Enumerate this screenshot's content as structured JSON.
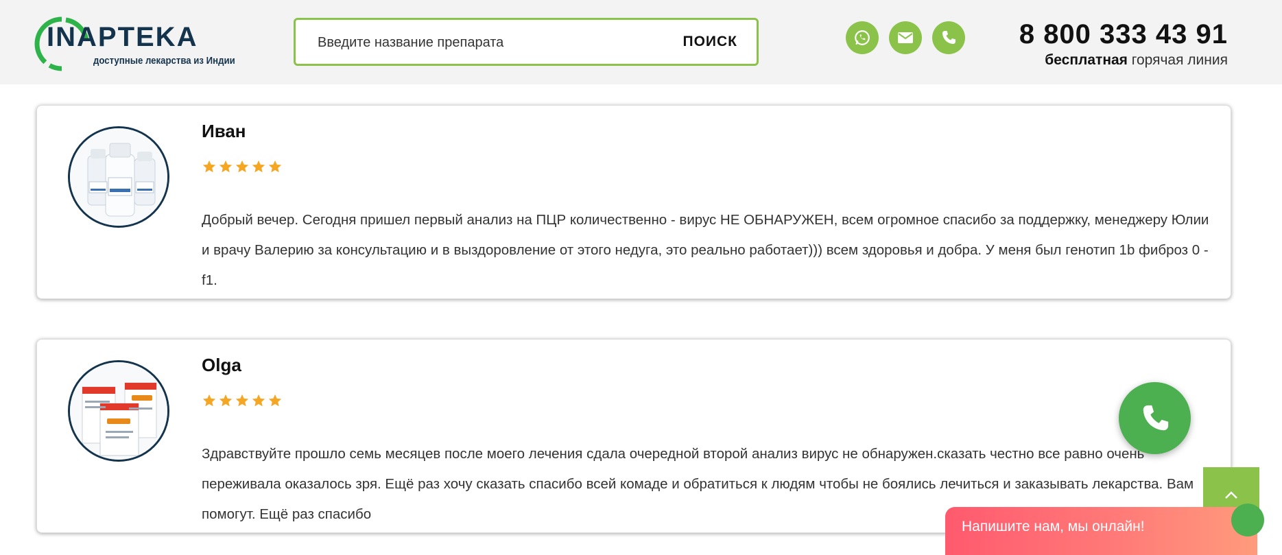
{
  "header": {
    "logo_text": "INAPTEKA",
    "logo_tagline": "доступные лекарства из Индии",
    "search": {
      "placeholder": "Введите название препарата",
      "button_label": "ПОИСК"
    },
    "contact_icons": [
      "whatsapp-icon",
      "mail-icon",
      "phone-icon"
    ],
    "phone": "8 800 333 43 91",
    "hotline_bold": "бесплатная",
    "hotline_rest": " горячая линия"
  },
  "reviews": [
    {
      "name": "Иван",
      "rating": 5,
      "text": "Добрый вечер. Сегодня пришел первый анализ на ПЦР количественно - вирус НЕ ОБНАРУЖЕН, всем огромное спасибо за поддержку, менеджеру Юлии и врачу Валерию за консультацию и в выздоровление от этого недуга, это реально работает))) всем здоровья и добра. У меня был генотип 1b фиброз 0 - f1."
    },
    {
      "name": "Olga",
      "rating": 5,
      "text": "Здравствуйте прошло семь месяцев после моего лечения сдала очередной второй анализ вирус не обнаружен.сказать честно все равно очень переживала оказалось зря. Ещё раз хочу сказать спасибо всей комаде и обратиться к людям чтобы не боялись лечиться и заказывать лекарства. Вам помогут. Ещё раз спасибо"
    }
  ],
  "chat": {
    "label": "Напишите нам, мы онлайн!"
  },
  "colors": {
    "accent_green": "#8bc34a",
    "call_green": "#4caf50",
    "brand_navy": "#14344d",
    "star": "#f5a623",
    "chat_gradient_start": "#ff5a6e"
  }
}
